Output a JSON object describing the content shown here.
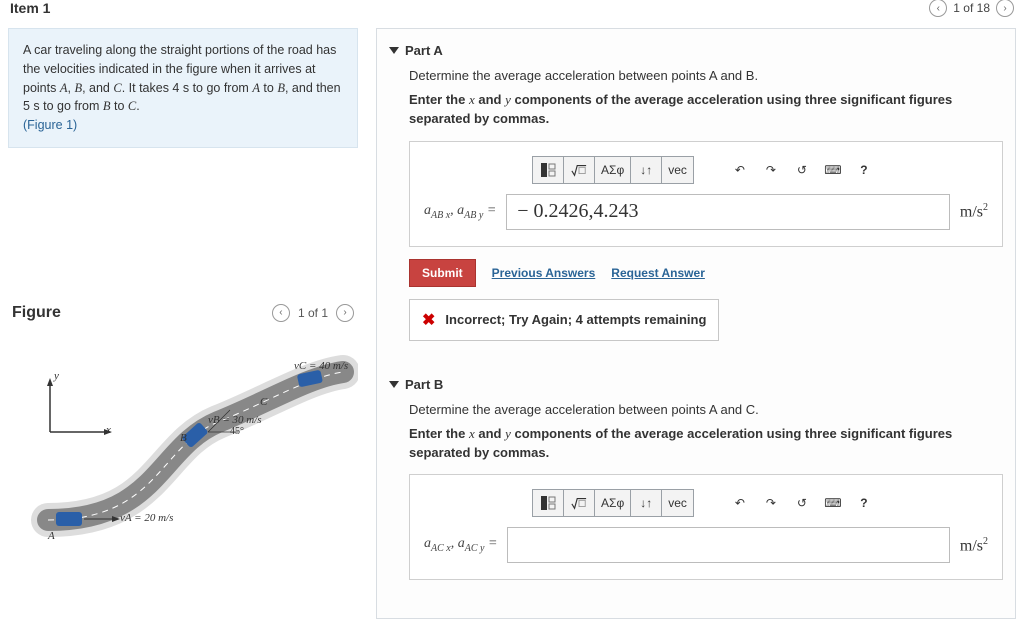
{
  "header": {
    "item_label": "Item 1",
    "page_of": "1 of 18"
  },
  "stem": {
    "intro_1": "A car traveling along the straight portions of the road has the velocities indicated in the figure when it arrives at points ",
    "A": "A",
    "B": "B",
    "C": "C",
    "intro_2": ". It takes 4 s to go from ",
    "intro_3": " to ",
    "intro_4": ", and then 5 s to go from ",
    "intro_5": " to ",
    "period": ".",
    "figure_link": "(Figure 1)"
  },
  "figure": {
    "title": "Figure",
    "page": "1 of 1",
    "labels": {
      "y": "y",
      "x": "x",
      "A": "A",
      "B": "B",
      "C": "C",
      "vA": "vA = 20 m/s",
      "vB": "vB = 30 m/s",
      "vC": "vC = 40 m/s",
      "angle45": "45°"
    }
  },
  "partA": {
    "title": "Part A",
    "question": "Determine the average acceleration between points A and B.",
    "instruction_pre": "Enter the ",
    "instruction_x": "x",
    "instruction_and": " and ",
    "instruction_y": "y",
    "instruction_post": " components of the average acceleration using three significant figures separated by commas.",
    "lhs": "aAB x, aAB y =",
    "value": "− 0.2426,4.243",
    "units": "m/s²",
    "submit": "Submit",
    "prev_answers": "Previous Answers",
    "request_answer": "Request Answer",
    "feedback": "Incorrect; Try Again; 4 attempts remaining"
  },
  "partB": {
    "title": "Part B",
    "question": "Determine the average acceleration between points A and C.",
    "instruction_pre": "Enter the ",
    "instruction_x": "x",
    "instruction_and": " and ",
    "instruction_y": "y",
    "instruction_post": " components of the average acceleration using three significant figures separated by commas.",
    "lhs": "aAC x, aAC y =",
    "value": "",
    "units": "m/s²"
  },
  "toolbar": {
    "template": "template",
    "sqrt": "√",
    "greek": "ΑΣφ",
    "updown": "↓↑",
    "vec": "vec",
    "undo": "↶",
    "redo": "↷",
    "reset": "↺",
    "keyboard": "⌨",
    "help": "?"
  }
}
